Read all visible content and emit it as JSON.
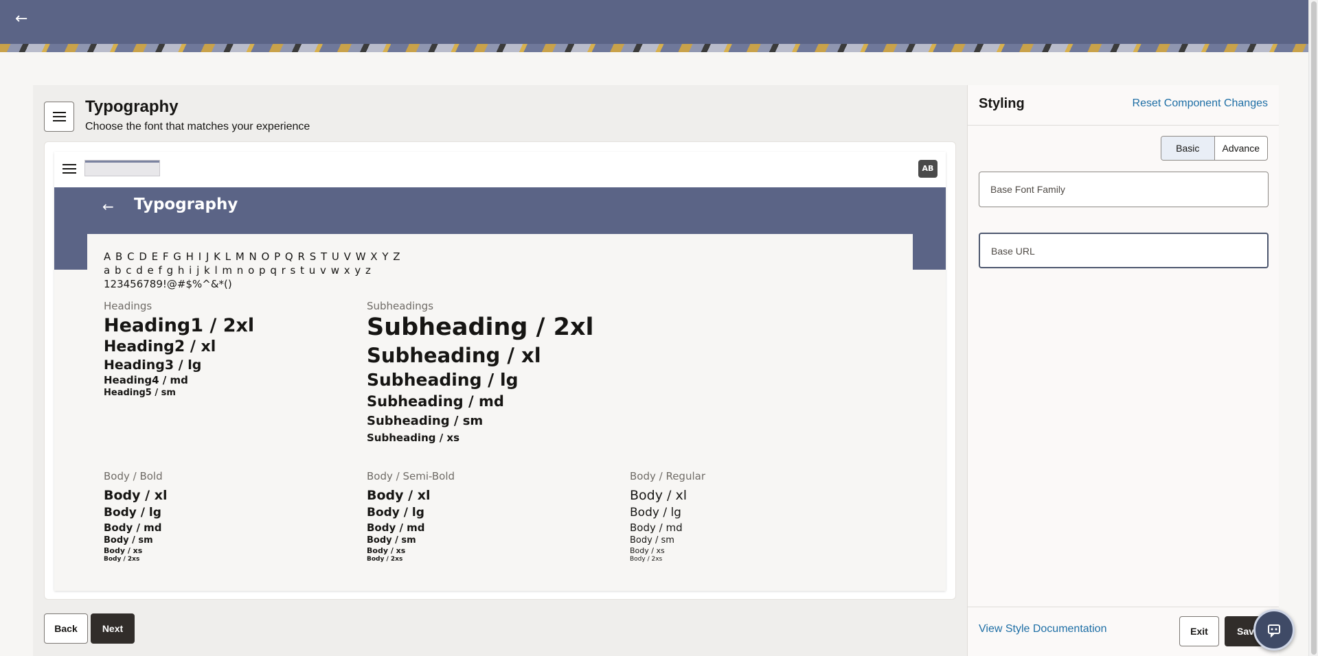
{
  "header": {
    "back_icon": "arrow-left-icon"
  },
  "main": {
    "title": "Typography",
    "subtitle": "Choose the font that matches your experience",
    "preview": {
      "avatar_initials": "AB",
      "title": "Typography",
      "alphabet_upper": "A B C D E F G H I J K L M N O P Q R S T U V W X Y Z",
      "alphabet_lower": "a b c d e f g h i j k l m n o p q r s t u v w x y z",
      "digits_symbols": "123456789!@#$%^&*()",
      "headings_label": "Headings",
      "headings": [
        "Heading1 / 2xl",
        "Heading2 / xl",
        "Heading3 / lg",
        "Heading4 / md",
        "Heading5 / sm"
      ],
      "subheadings_label": "Subheadings",
      "subheadings": [
        "Subheading / 2xl",
        "Subheading / xl",
        "Subheading / lg",
        "Subheading / md",
        "Subheading / sm",
        "Subheading / xs"
      ],
      "body_bold_label": "Body / Bold",
      "body_semibold_label": "Body / Semi-Bold",
      "body_regular_label": "Body / Regular",
      "body_sizes": [
        "Body / xl",
        "Body / lg",
        "Body / md",
        "Body / sm",
        "Body / xs",
        "Body / 2xs"
      ]
    },
    "back_label": "Back",
    "next_label": "Next"
  },
  "side": {
    "title": "Styling",
    "reset_label": "Reset Component Changes",
    "tabs": [
      "Basic",
      "Advance"
    ],
    "selected_tab": "Basic",
    "base_font_family_placeholder": "Base Font Family",
    "base_url_placeholder": "Base URL",
    "doc_link": "View Style Documentation",
    "exit_label": "Exit",
    "save_label": "Save"
  },
  "colors": {
    "banner": "#5b6486",
    "primary_button": "#312d2a",
    "link": "#1d6ea5"
  }
}
